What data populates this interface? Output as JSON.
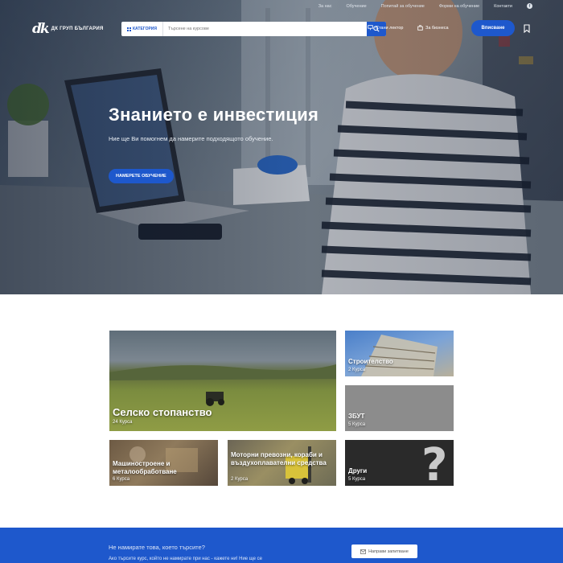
{
  "topbar": {
    "links": [
      "За нас",
      "Обучение",
      "Попитай за обучение",
      "Форми на обучение",
      "Контакти"
    ],
    "social_icon": "facebook-icon"
  },
  "brand": {
    "logo_mark": "dk",
    "logo_text": "ДК ГРУП БЪЛГАРИЯ"
  },
  "search": {
    "category_label": "КАТЕГОРИЯ",
    "placeholder": "Търсене на курсове",
    "button_icon": "search-icon"
  },
  "nav": {
    "teacher_label": "Стани лектор",
    "business_label": "За бизнеса",
    "signup_label": "Вписване",
    "bookmark_icon": "bookmark-icon"
  },
  "hero": {
    "title": "Знанието е инвестиция",
    "subtitle": "Ние ще Ви помогнем да намерите подходящото обучение.",
    "cta_label": "НАМЕРЕТЕ ОБУЧЕНИЕ"
  },
  "categories": [
    {
      "title": "Селско стопанство",
      "count": "24 Курса"
    },
    {
      "title": "Строителство",
      "count": "2 Курса"
    },
    {
      "title": "ЗБУТ",
      "count": "5 Курса"
    },
    {
      "title": "Машиностроене и металообработване",
      "count": "6 Курса"
    },
    {
      "title": "Моторни превозни, кораби и въздухоплавателни средства",
      "count": "2 Курса"
    },
    {
      "title": "Други",
      "count": "5 Курса"
    }
  ],
  "contact_band": {
    "question": "Не намирате това, което търсите?",
    "text": "Ако търсите курс, който не намирате при нас - кажете ни! Ние ще се",
    "button_label": "Направи запитване"
  },
  "colors": {
    "accent": "#1e58cc",
    "tile_gray": "#8c8c8c",
    "tile_dark": "#2a2a2a"
  }
}
